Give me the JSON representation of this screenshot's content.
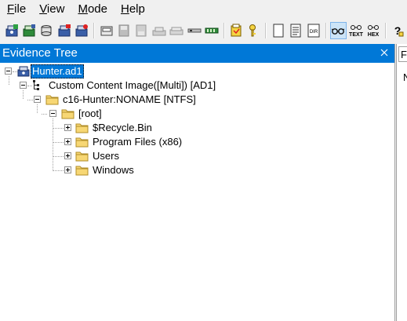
{
  "menu": {
    "items": [
      {
        "label": "File",
        "mnemonic": "F"
      },
      {
        "label": "View",
        "mnemonic": "V"
      },
      {
        "label": "Mode",
        "mnemonic": "M"
      },
      {
        "label": "Help",
        "mnemonic": "H"
      }
    ]
  },
  "toolbar": {
    "icons": [
      "add-evidence-icon",
      "add-all-evidence-icon",
      "image-mounting-icon",
      "remove-evidence-icon",
      "remove-all-evidence-icon",
      "create-disk-image-icon",
      "export-disk-image-icon",
      "capture-memory-icon",
      "obtain-protected-files-icon",
      "detect-encrypted-icon",
      "verify-drive-icon",
      "decrypt-ad1-icon",
      "add-to-custom-content-icon",
      "custom-content-key-icon",
      "text-view-icon",
      "natural-view-icon",
      "directory-view-icon",
      "auto-view-icon",
      "text-mode-icon",
      "hex-mode-icon",
      "help-icon"
    ],
    "text_mode_label": "TEXT",
    "hex_mode_label": "HEX"
  },
  "evidence_tree": {
    "title": "Evidence Tree",
    "nodes": {
      "root": "Hunter.ad1",
      "image": "Custom Content Image([Multi]) [AD1]",
      "partition": "c16-Hunter:NONAME [NTFS]",
      "root_folder": "[root]",
      "recycle": "$Recycle.Bin",
      "program_files": "Program Files (x86)",
      "users": "Users",
      "windows": "Windows"
    }
  },
  "right_pane": {
    "tab_label": "Fi",
    "text": "N"
  },
  "colors": {
    "accent": "#0078d7",
    "folder": "#f7d774"
  }
}
